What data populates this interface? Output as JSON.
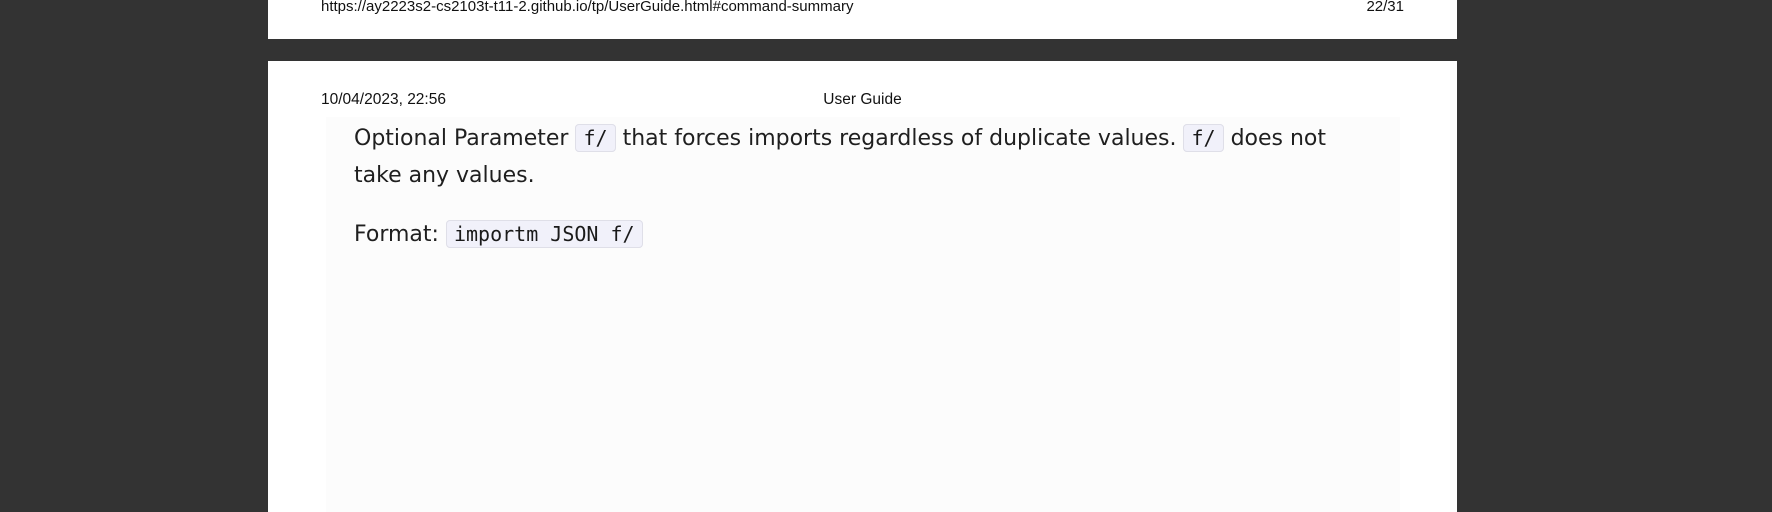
{
  "previous_page": {
    "footer_url": "https://ay2223s2-cs2103t-t11-2.github.io/tp/UserGuide.html#command-summary",
    "page_number": "22/31"
  },
  "current_page": {
    "header_date": "10/04/2023, 22:56",
    "header_title": "User Guide",
    "paragraph_1": {
      "text_before": "Optional Parameter",
      "code_1": "f/",
      "text_middle": "that forces imports regardless of duplicate values.",
      "code_2": "f/",
      "text_after": "does not take any values."
    },
    "paragraph_2": {
      "label": "Format:",
      "code": "importm JSON f/"
    }
  },
  "colors": {
    "viewer_background": "#333333",
    "page_background": "#ffffff",
    "content_background": "#fcfcfc",
    "code_background": "#f1f1fa"
  }
}
